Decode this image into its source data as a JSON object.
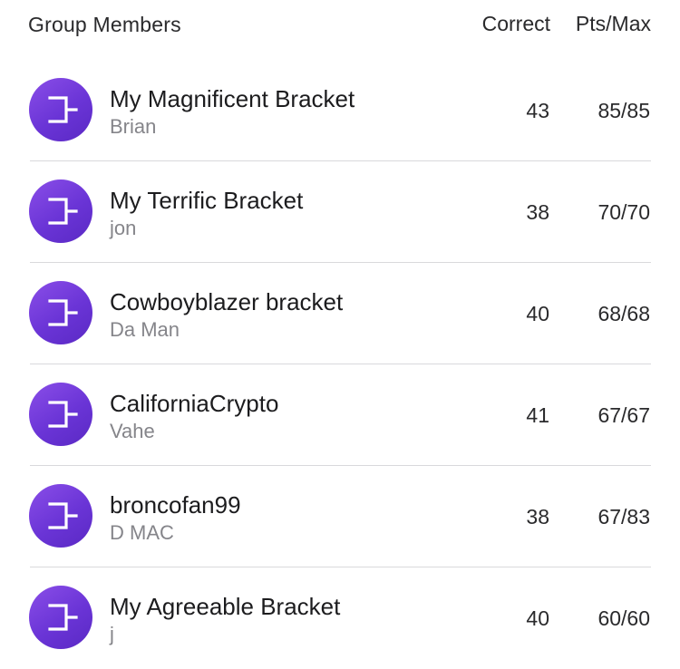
{
  "header": {
    "title": "Group Members",
    "correct_label": "Correct",
    "pts_label": "Pts/Max"
  },
  "members": [
    {
      "bracket": "My Magnificent Bracket",
      "owner": "Brian",
      "correct": "43",
      "pts": "85/85",
      "icon": "bracket-icon"
    },
    {
      "bracket": "My Terrific Bracket",
      "owner": "jon",
      "correct": "38",
      "pts": "70/70",
      "icon": "bracket-icon"
    },
    {
      "bracket": "Cowboyblazer bracket",
      "owner": "Da Man",
      "correct": "40",
      "pts": "68/68",
      "icon": "bracket-icon"
    },
    {
      "bracket": "CaliforniaCrypto",
      "owner": "Vahe",
      "correct": "41",
      "pts": "67/67",
      "icon": "bracket-icon"
    },
    {
      "bracket": "broncofan99",
      "owner": "D MAC",
      "correct": "38",
      "pts": "67/83",
      "icon": "bracket-icon"
    },
    {
      "bracket": "My Agreeable Bracket",
      "owner": "j",
      "correct": "40",
      "pts": "60/60",
      "icon": "bracket-icon"
    }
  ],
  "colors": {
    "avatar_gradient_start": "#8a4ee8",
    "avatar_gradient_end": "#5a29c4",
    "secondary_text": "#85858a",
    "divider": "#d9d9dc"
  }
}
